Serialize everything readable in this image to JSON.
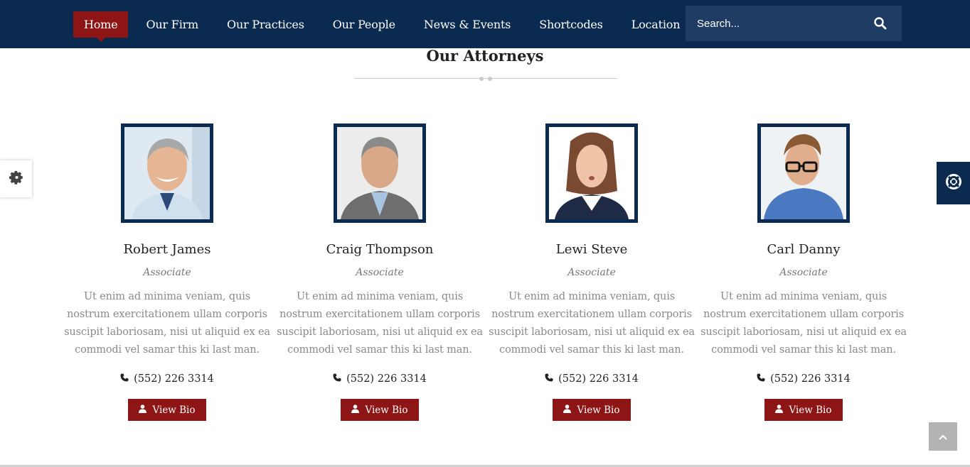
{
  "nav": {
    "items": [
      {
        "label": "Home",
        "active": true
      },
      {
        "label": "Our Firm"
      },
      {
        "label": "Our Practices"
      },
      {
        "label": "Our People"
      },
      {
        "label": "News & Events"
      },
      {
        "label": "Shortcodes"
      },
      {
        "label": "Location"
      }
    ],
    "search_placeholder": "Search..."
  },
  "section": {
    "title": "Our Attorneys"
  },
  "attorneys": [
    {
      "name": "Robert James",
      "role": "Associate",
      "bio": "Ut enim ad minima veniam, quis nostrum exercitationem ullam corporis suscipit laboriosam, nisi ut aliquid ex ea commodi vel samar this ki last man.",
      "phone": "(552) 226 3314",
      "button": "View Bio"
    },
    {
      "name": "Craig Thompson",
      "role": "Associate",
      "bio": "Ut enim ad minima veniam, quis nostrum exercitationem ullam corporis suscipit laboriosam, nisi ut aliquid ex ea commodi vel samar this ki last man.",
      "phone": "(552) 226 3314",
      "button": "View Bio"
    },
    {
      "name": "Lewi Steve",
      "role": "Associate",
      "bio": "Ut enim ad minima veniam, quis nostrum exercitationem ullam corporis suscipit laboriosam, nisi ut aliquid ex ea commodi vel samar this ki last man.",
      "phone": "(552) 226 3314",
      "button": "View Bio"
    },
    {
      "name": "Carl Danny",
      "role": "Associate",
      "bio": "Ut enim ad minima veniam, quis nostrum exercitationem ullam corporis suscipit laboriosam, nisi ut aliquid ex ea commodi vel samar this ki last man.",
      "phone": "(552) 226 3314",
      "button": "View Bio"
    }
  ],
  "icons": {
    "search": "search-icon",
    "settings": "gear-icon",
    "help": "lifebuoy-icon",
    "phone": "phone-icon",
    "user": "user-icon",
    "scroll_top": "chevron-up-icon"
  },
  "colors": {
    "navy": "#0b2a4f",
    "accent_red": "#8d1515",
    "search_bg": "#1f3d63"
  }
}
